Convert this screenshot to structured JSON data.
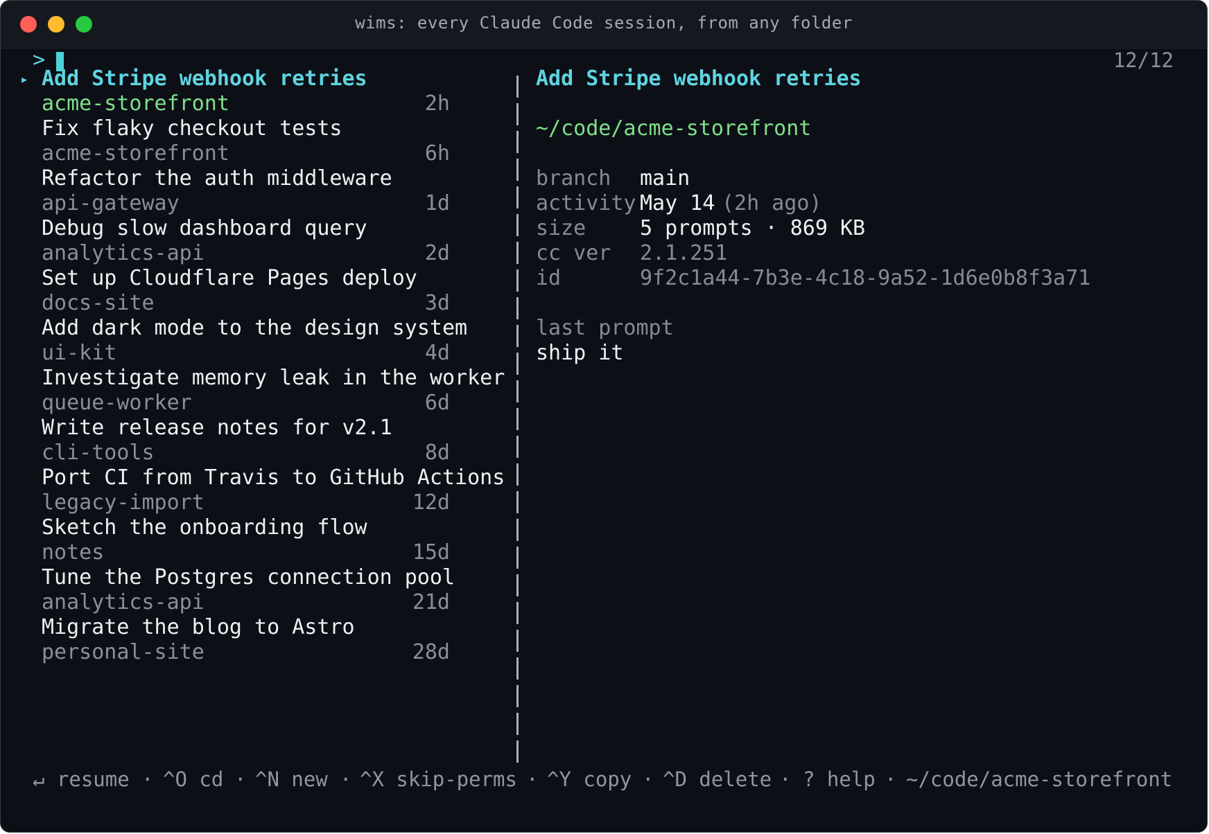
{
  "window": {
    "title": "wims: every Claude Code session, from any folder"
  },
  "prompt": {
    "symbol": ">",
    "value": "",
    "count": "12/12"
  },
  "sessions": [
    {
      "title": "Add Stripe webhook retries",
      "project": "acme-storefront",
      "age": "2h",
      "selected": true
    },
    {
      "title": "Fix flaky checkout tests",
      "project": "acme-storefront",
      "age": "6h"
    },
    {
      "title": "Refactor the auth middleware",
      "project": "api-gateway",
      "age": "1d"
    },
    {
      "title": "Debug slow dashboard query",
      "project": "analytics-api",
      "age": "2d"
    },
    {
      "title": "Set up Cloudflare Pages deploy",
      "project": "docs-site",
      "age": "3d"
    },
    {
      "title": "Add dark mode to the design system",
      "project": "ui-kit",
      "age": "4d"
    },
    {
      "title": "Investigate memory leak in the worker",
      "project": "queue-worker",
      "age": "6d"
    },
    {
      "title": "Write release notes for v2.1",
      "project": "cli-tools",
      "age": "8d"
    },
    {
      "title": "Port CI from Travis to GitHub Actions",
      "project": "legacy-import",
      "age": "12d"
    },
    {
      "title": "Sketch the onboarding flow",
      "project": "notes",
      "age": "15d"
    },
    {
      "title": "Tune the Postgres connection pool",
      "project": "analytics-api",
      "age": "21d"
    },
    {
      "title": "Migrate the blog to Astro",
      "project": "personal-site",
      "age": "28d"
    }
  ],
  "detail": {
    "title": "Add Stripe webhook retries",
    "path": "~/code/acme-storefront",
    "fields": {
      "branch_label": "branch",
      "branch_value": "main",
      "activity_label": "activity",
      "activity_date": "May 14",
      "activity_ago": "(2h ago)",
      "size_label": "size",
      "size_value": "5 prompts · 869 KB",
      "ccver_label": "cc ver",
      "ccver_value": "2.1.251",
      "id_label": "id",
      "id_value": "9f2c1a44-7b3e-4c18-9a52-1d6e0b8f3a71"
    },
    "last_prompt_label": "last prompt",
    "last_prompt_value": "ship it"
  },
  "footer": {
    "resume": "↵ resume",
    "cd": "^O cd",
    "new": "^N new",
    "skip": "^X skip-perms",
    "copy": "^Y copy",
    "delete": "^D delete",
    "help": "? help",
    "sep": "·",
    "cwd": "~/code/acme-storefront"
  },
  "colors": {
    "accent": "#5fd4e0",
    "project_active": "#7fe08a",
    "background": "#0c0f16"
  }
}
